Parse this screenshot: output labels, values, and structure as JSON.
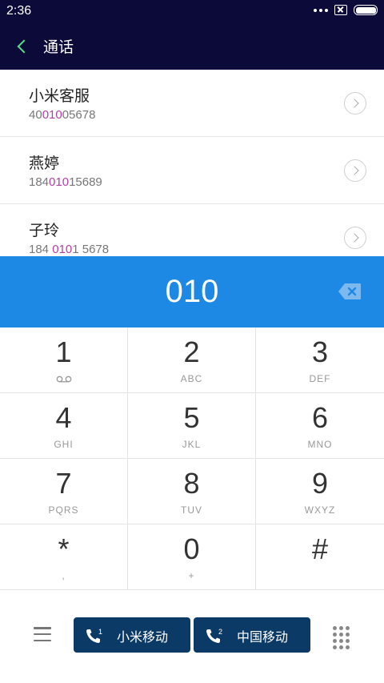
{
  "status_bar": {
    "time": "2:36"
  },
  "header": {
    "title": "通话"
  },
  "contacts": [
    {
      "name": "小米客服",
      "number_pre": "40",
      "number_hl": "010",
      "number_post": "05678"
    },
    {
      "name": "燕婷",
      "number_pre": "184",
      "number_hl": "010",
      "number_post": "15689"
    },
    {
      "name": "子玲",
      "number_pre": "184 ",
      "number_hl": "010",
      "number_post": "1 5678"
    }
  ],
  "dial_input": {
    "value": "010"
  },
  "keypad": [
    {
      "digit": "1",
      "sub": ""
    },
    {
      "digit": "2",
      "sub": "ABC"
    },
    {
      "digit": "3",
      "sub": "DEF"
    },
    {
      "digit": "4",
      "sub": "GHI"
    },
    {
      "digit": "5",
      "sub": "JKL"
    },
    {
      "digit": "6",
      "sub": "MNO"
    },
    {
      "digit": "7",
      "sub": "PQRS"
    },
    {
      "digit": "8",
      "sub": "TUV"
    },
    {
      "digit": "9",
      "sub": "WXYZ"
    },
    {
      "digit": "*",
      "sub": ","
    },
    {
      "digit": "0",
      "sub": "+"
    },
    {
      "digit": "#",
      "sub": ""
    }
  ],
  "call_buttons": [
    {
      "sim": "1",
      "label": "小米移动"
    },
    {
      "sim": "2",
      "label": "中国移动"
    }
  ],
  "icons": {
    "back": "back-chevron-icon",
    "contact_arrow": "chevron-right-circle-icon",
    "backspace": "backspace-icon",
    "voicemail": "voicemail-icon",
    "menu": "menu-icon",
    "call": "phone-icon",
    "keypad_toggle": "dialpad-icon"
  },
  "colors": {
    "header_bg": "#0b0a38",
    "back_accent": "#59e08a",
    "input_bg": "#1e88e5",
    "match_highlight": "#b23fa3",
    "call_button_bg": "#0c3a66"
  }
}
